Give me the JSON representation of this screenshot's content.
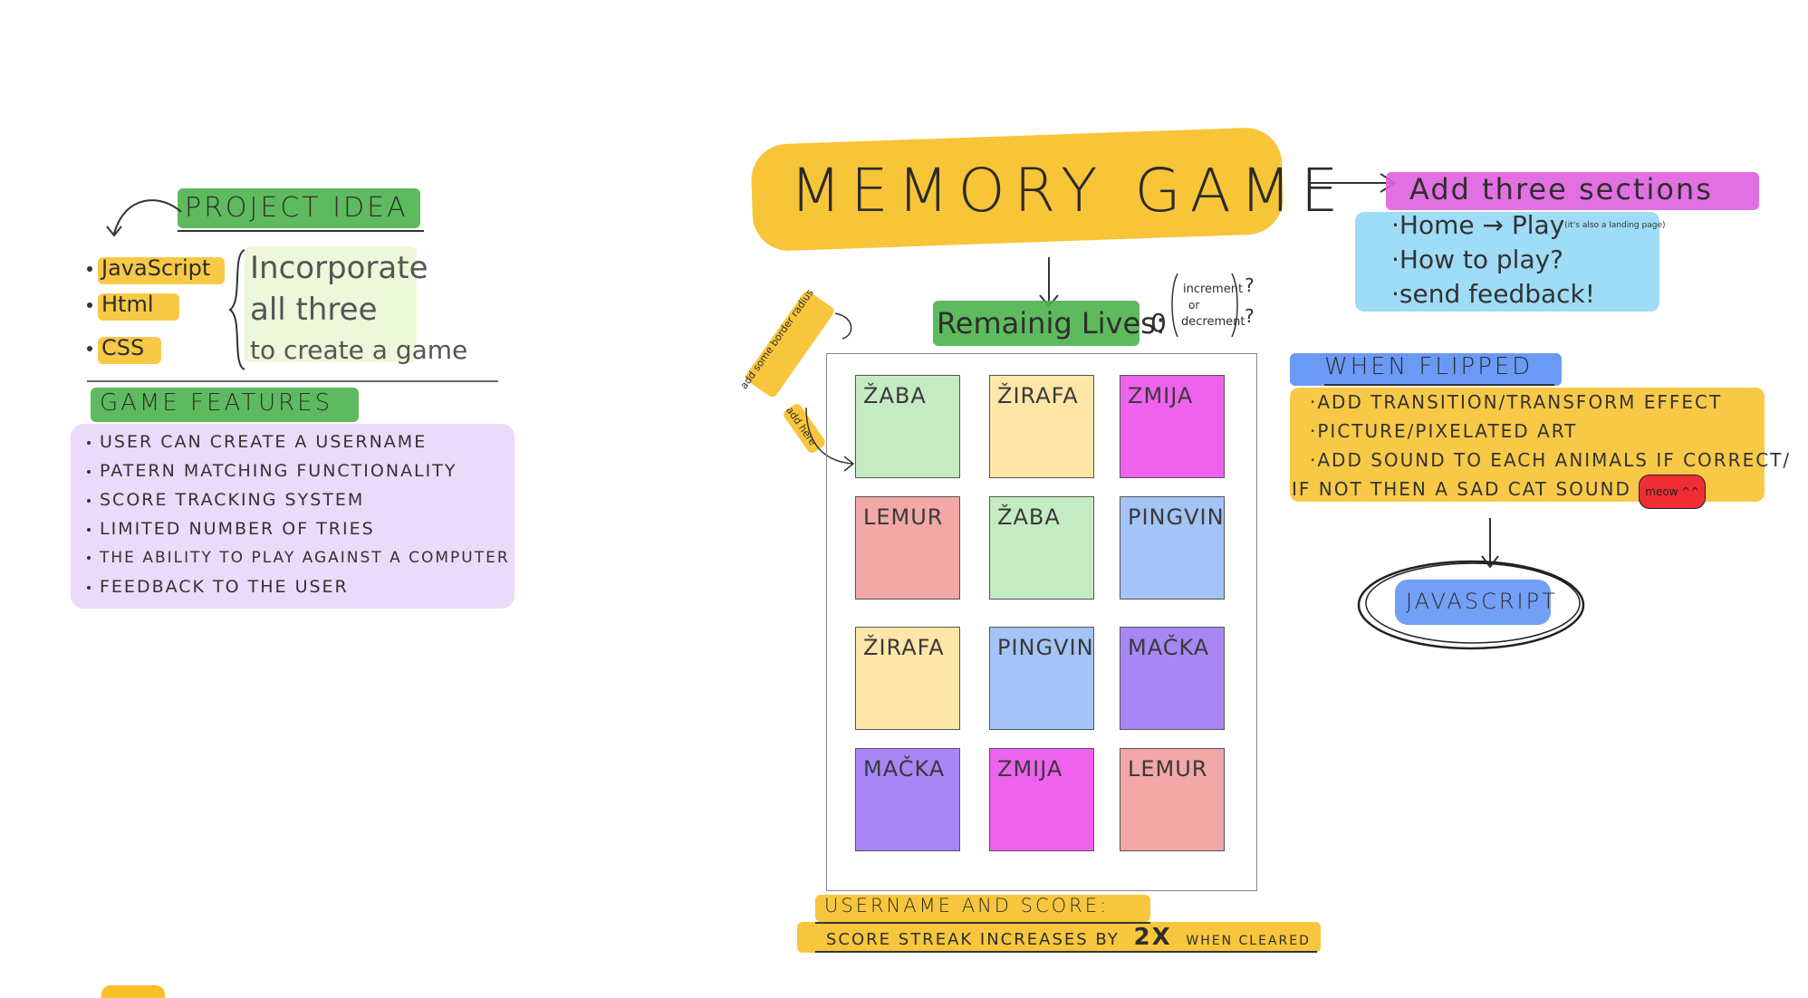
{
  "colors": {
    "green": "#4cb24c",
    "yellow": "#f7c027",
    "light_green": "#e8f5d0",
    "lavender": "#e4cdf7",
    "magenta": "#e060e0",
    "sky": "#7fd0f5",
    "blue": "#5b8ef5",
    "red": "#f02d35"
  },
  "project_idea": {
    "title": "Project Idea",
    "languages": [
      "JavaScript",
      "Html",
      "CSS"
    ],
    "note_lines": [
      "Incorporate",
      "all three",
      "to create a game"
    ]
  },
  "game_features": {
    "title": "Game Features",
    "items": [
      "User can create a username",
      "Patern matching functionality",
      "Score tracking system",
      "Limited number of tries",
      "The ability to play against a computer",
      "Feedback to the user"
    ]
  },
  "title": "MEMORY GAME",
  "lives": {
    "label": "Remainig Lives:",
    "value": "0",
    "note_lines": [
      "increment",
      "or",
      "decrement"
    ],
    "marks": "? ?"
  },
  "side_notes": {
    "border_radius": "add some border radius",
    "add_here": "add here"
  },
  "cards": [
    {
      "label": "ŽABA",
      "color": "#c5ebc3"
    },
    {
      "label": "ŽIRAFA",
      "color": "#fde6a8"
    },
    {
      "label": "ZMIJA",
      "color": "#ee62ee"
    },
    {
      "label": "LEMUR",
      "color": "#f3a7a7"
    },
    {
      "label": "ŽABA",
      "color": "#c5ebc3"
    },
    {
      "label": "PINGVIN",
      "color": "#a4c3f7"
    },
    {
      "label": "ŽIRAFA",
      "color": "#fde6a8"
    },
    {
      "label": "PINGVIN",
      "color": "#a4c3f7"
    },
    {
      "label": "MAČKA",
      "color": "#a886f5"
    },
    {
      "label": "MAČKA",
      "color": "#a886f5"
    },
    {
      "label": "ZMIJA",
      "color": "#ee62ee"
    },
    {
      "label": "LEMUR",
      "color": "#f3a7a7"
    }
  ],
  "score": {
    "line1": "Username and score:",
    "line2_prefix": "Score streak increases by",
    "line2_mult": "2x",
    "line2_suffix": "when cleared"
  },
  "sections": {
    "title": "Add three sections",
    "home": "Home",
    "play": "Play",
    "play_note": "(it's also a landing page)",
    "how_to": "How to play?",
    "feedback": "send feedback!"
  },
  "when_flipped": {
    "title": "When flipped",
    "items": [
      "Add transition/transform effect",
      "Picture/pixelated art",
      "Add sound to each animals if correct/",
      "if not then a sad cat sound"
    ],
    "meow": "meow ^^"
  },
  "js_bubble": "JavaScript"
}
